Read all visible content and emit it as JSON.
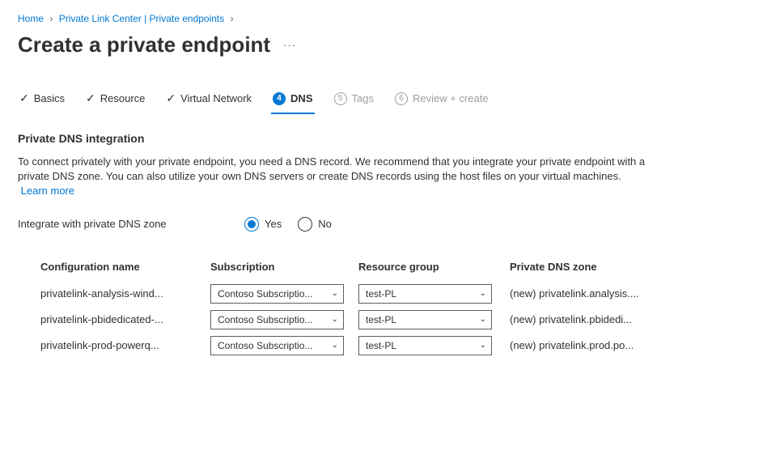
{
  "breadcrumb": {
    "home": "Home",
    "center": "Private Link Center | Private endpoints"
  },
  "title": "Create a private endpoint",
  "tabs": {
    "basics": "Basics",
    "resource": "Resource",
    "vnet": "Virtual Network",
    "dns_num": "4",
    "dns": "DNS",
    "tags_num": "5",
    "tags": "Tags",
    "review_num": "6",
    "review": "Review + create"
  },
  "section": {
    "heading": "Private DNS integration",
    "desc": "To connect privately with your private endpoint, you need a DNS record. We recommend that you integrate your private endpoint with a private DNS zone. You can also utilize your own DNS servers or create DNS records using the host files on your virtual machines.",
    "learn_more": "Learn more"
  },
  "radio": {
    "label": "Integrate with private DNS zone",
    "yes": "Yes",
    "no": "No",
    "selected": "yes"
  },
  "table": {
    "headers": {
      "name": "Configuration name",
      "sub": "Subscription",
      "rg": "Resource group",
      "zone": "Private DNS zone"
    },
    "rows": [
      {
        "name": "privatelink-analysis-wind...",
        "sub": "Contoso Subscriptio...",
        "rg": "test-PL",
        "zone": "(new) privatelink.analysis...."
      },
      {
        "name": "privatelink-pbidedicated-...",
        "sub": "Contoso Subscriptio...",
        "rg": "test-PL",
        "zone": "(new) privatelink.pbidedi..."
      },
      {
        "name": "privatelink-prod-powerq...",
        "sub": "Contoso Subscriptio...",
        "rg": "test-PL",
        "zone": "(new) privatelink.prod.po..."
      }
    ]
  }
}
